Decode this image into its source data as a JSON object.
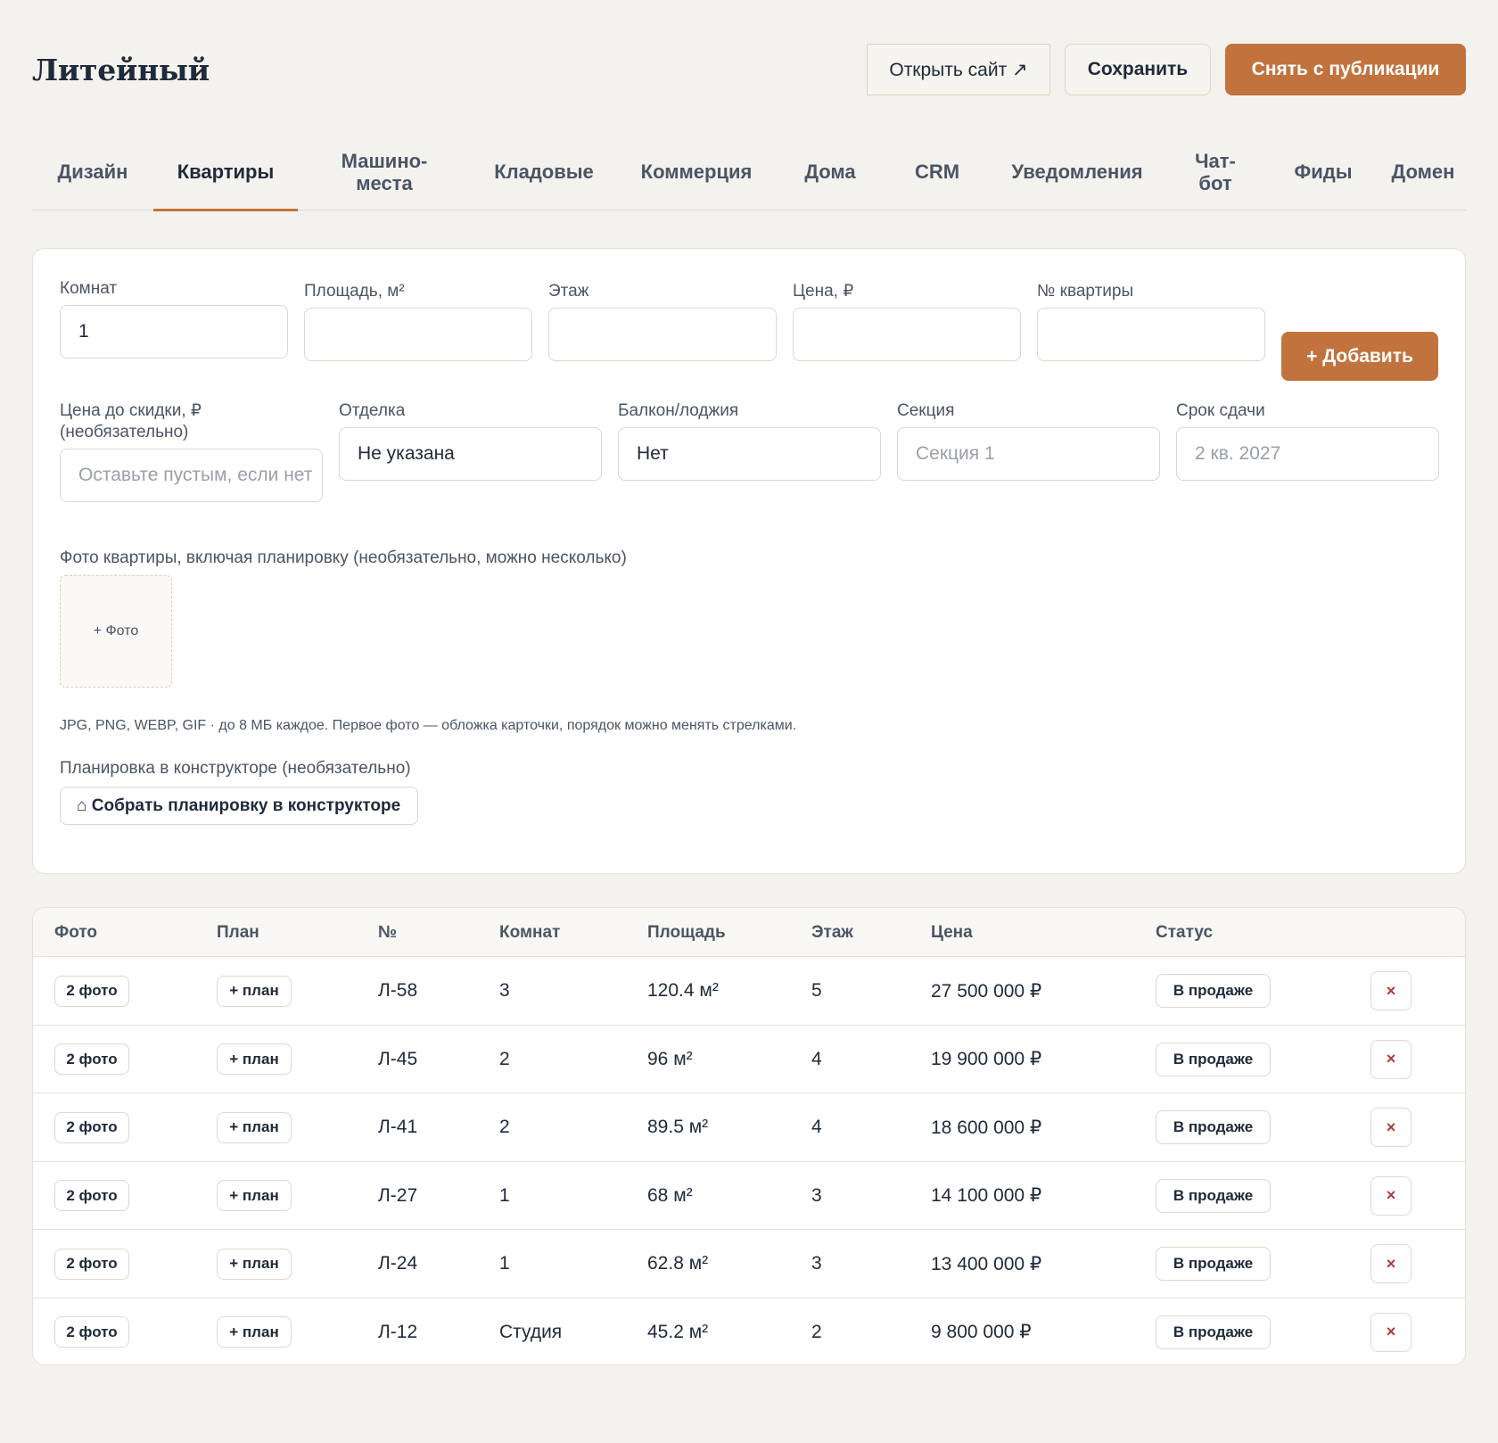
{
  "header": {
    "title": "Литейный",
    "open_site": "Открыть сайт ↗",
    "save": "Сохранить",
    "unpublish": "Снять с публикации",
    "accent_color": "#c2733d"
  },
  "tabs": [
    {
      "label": "Дизайн"
    },
    {
      "label": "Квартиры",
      "active": true
    },
    {
      "label": "Машино-\nместа"
    },
    {
      "label": "Кладовые"
    },
    {
      "label": "Коммерция"
    },
    {
      "label": "Дома"
    },
    {
      "label": "CRM"
    },
    {
      "label": "Уведомления"
    },
    {
      "label": "Чат-\nбот"
    },
    {
      "label": "Фиды"
    },
    {
      "label": "Домен"
    }
  ],
  "form": {
    "rooms": {
      "label": "Комнат",
      "value": "1"
    },
    "area": {
      "label": "Площадь, м²",
      "value": ""
    },
    "floor": {
      "label": "Этаж",
      "value": ""
    },
    "price": {
      "label": "Цена, ₽",
      "value": ""
    },
    "number": {
      "label": "№ квартиры",
      "value": ""
    },
    "add_button": "+ Добавить",
    "old_price": {
      "label": "Цена до скидки, ₽\n(необязательно)",
      "placeholder": "Оставьте пустым, если нет"
    },
    "finish": {
      "label": "Отделка",
      "value": "Не указана"
    },
    "balcony": {
      "label": "Балкон/лоджия",
      "value": "Нет"
    },
    "section": {
      "label": "Секция",
      "placeholder": "Секция 1"
    },
    "deadline": {
      "label": "Срок сдачи",
      "placeholder": "2 кв. 2027"
    },
    "photos_label": "Фото квартиры, включая планировку (необязательно, можно несколько)",
    "photo_button": "+ Фото",
    "hint": "JPG, PNG, WEBP, GIF · до 8 МБ каждое. Первое фото — обложка карточки, порядок можно менять стрелками.",
    "planner_label": "Планировка в конструкторе (необязательно)",
    "planner_icon": "home-icon",
    "planner_button": "⌂ Собрать планировку в конструкторе"
  },
  "table": {
    "columns": [
      "Фото",
      "План",
      "№",
      "Комнат",
      "Площадь",
      "Этаж",
      "Цена",
      "Статус"
    ],
    "rows": [
      {
        "photos": "2 фото",
        "plan": "+ план",
        "number": "Л-58",
        "rooms": "3",
        "area": "120.4 м²",
        "floor": "5",
        "price": "27 500 000 ₽",
        "status": "В продаже",
        "delete": "×"
      },
      {
        "photos": "2 фото",
        "plan": "+ план",
        "number": "Л-45",
        "rooms": "2",
        "area": "96 м²",
        "floor": "4",
        "price": "19 900 000 ₽",
        "status": "В продаже",
        "delete": "×"
      },
      {
        "photos": "2 фото",
        "plan": "+ план",
        "number": "Л-41",
        "rooms": "2",
        "area": "89.5 м²",
        "floor": "4",
        "price": "18 600 000 ₽",
        "status": "В продаже",
        "delete": "×"
      },
      {
        "photos": "2 фото",
        "plan": "+ план",
        "number": "Л-27",
        "rooms": "1",
        "area": "68 м²",
        "floor": "3",
        "price": "14 100 000 ₽",
        "status": "В продаже",
        "delete": "×"
      },
      {
        "photos": "2 фото",
        "plan": "+ план",
        "number": "Л-24",
        "rooms": "1",
        "area": "62.8 м²",
        "floor": "3",
        "price": "13 400 000 ₽",
        "status": "В продаже",
        "delete": "×"
      },
      {
        "photos": "2 фото",
        "plan": "+ план",
        "number": "Л-12",
        "rooms": "Студия",
        "area": "45.2 м²",
        "floor": "2",
        "price": "9 800 000 ₽",
        "status": "В продаже",
        "delete": "×"
      }
    ]
  }
}
